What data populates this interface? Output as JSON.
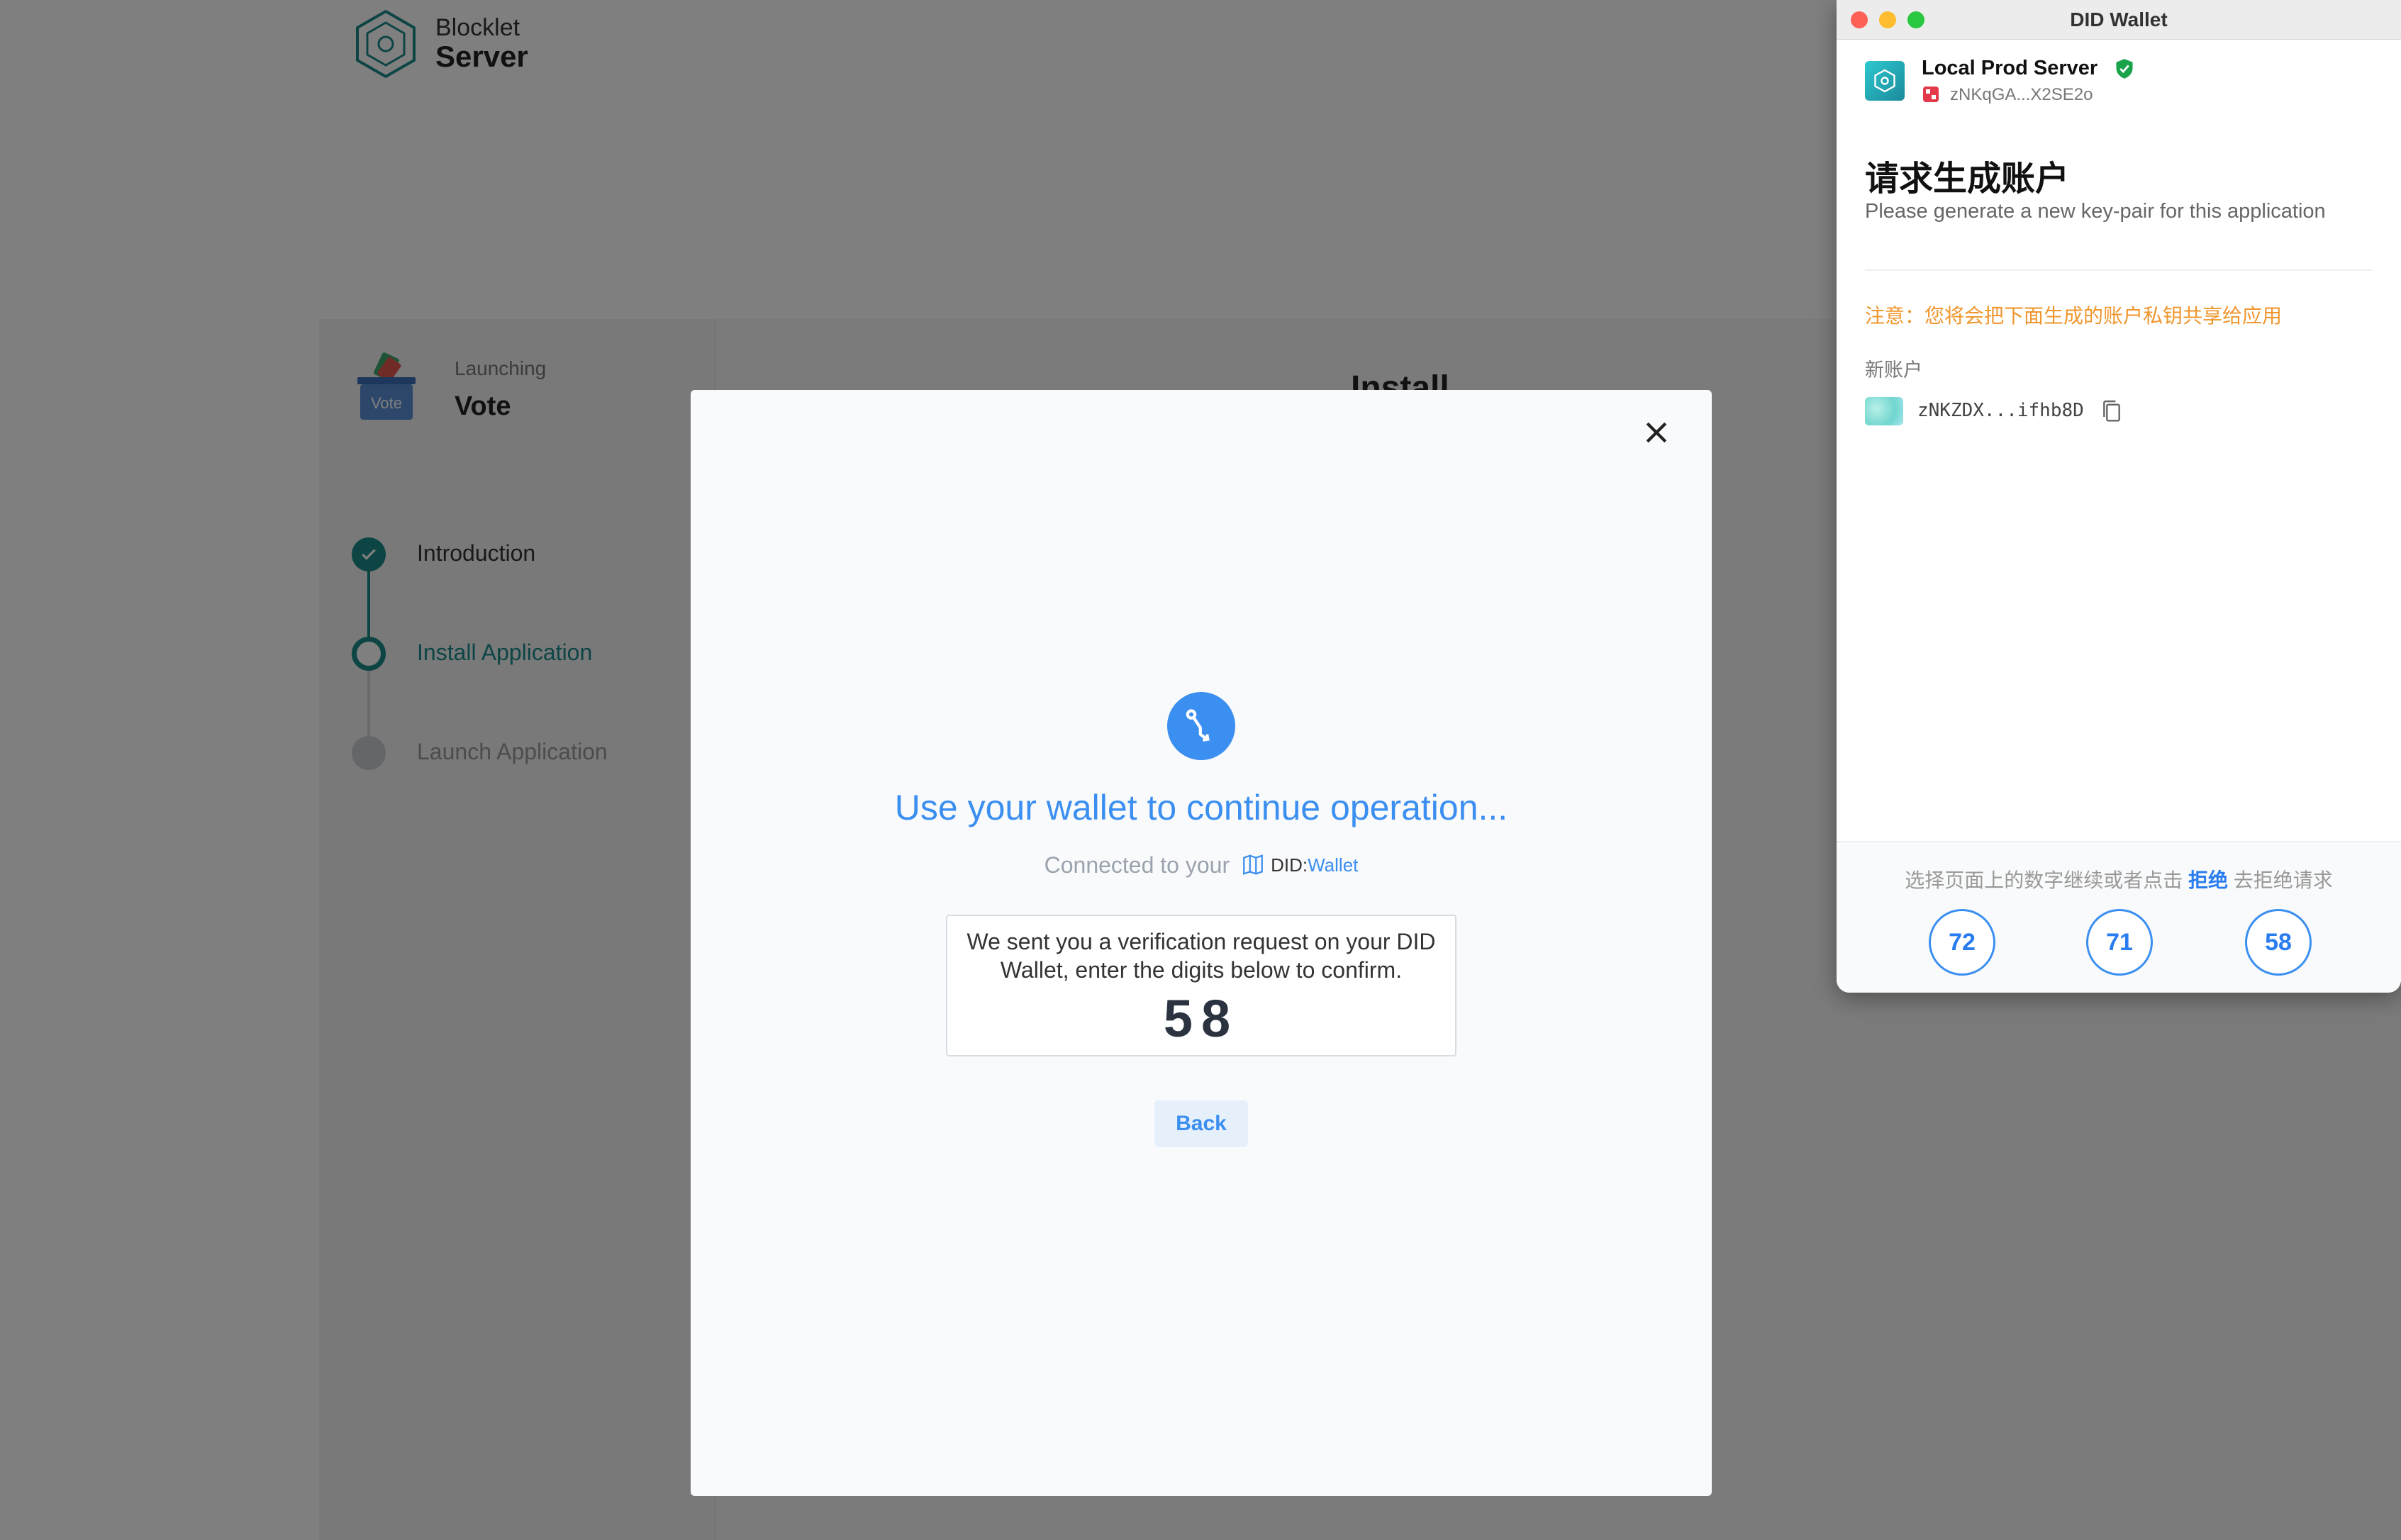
{
  "background_page": {
    "logo": {
      "line1": "Blocklet",
      "line2": "Server"
    },
    "launch": {
      "launching_label": "Launching",
      "app_name": "Vote",
      "app_icon_text": "Vote",
      "install_heading": "Install",
      "steps": [
        {
          "label": "Introduction",
          "state": "done"
        },
        {
          "label": "Install Application",
          "state": "active"
        },
        {
          "label": "Launch Application",
          "state": "pending"
        }
      ]
    }
  },
  "modal": {
    "title": "Use your wallet to continue operation...",
    "connected_prefix": "Connected to your",
    "did_label": "DID:",
    "did_wallet_label": "Wallet",
    "verify_text": "We sent you a verification request on your DID Wallet, enter the digits below to confirm.",
    "verify_digits": "58",
    "back_label": "Back",
    "accent_color": "#3b8ff0"
  },
  "wallet_window": {
    "title": "DID Wallet",
    "server_name": "Local Prod Server",
    "server_did": "zNKqGA...X2SE2o",
    "request_title": "请求生成账户",
    "request_subtitle": "Please generate a new key-pair for this application",
    "warning": "注意：您将会把下面生成的账户私钥共享给应用",
    "new_account_label": "新账户",
    "account_did": "zNKZDX...ifhb8D",
    "footer_hint_prefix": "选择页面上的数字继续或者点击",
    "footer_reject": "拒绝",
    "footer_hint_suffix": "去拒绝请求",
    "digit_options": [
      "72",
      "71",
      "58"
    ],
    "warning_color": "#f0962e"
  }
}
